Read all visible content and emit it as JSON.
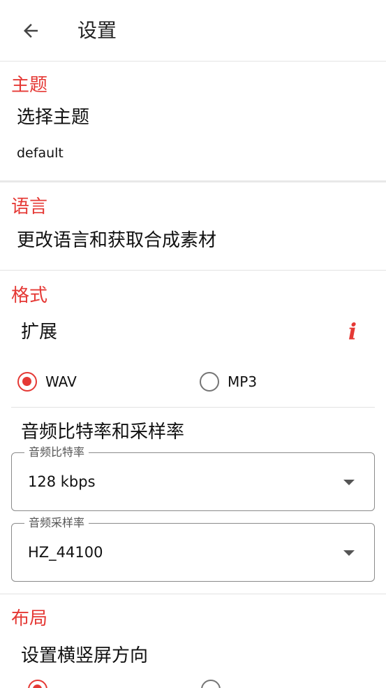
{
  "appbar": {
    "back_icon": "arrow-left-icon",
    "title": "设置"
  },
  "theme": {
    "section": "主题",
    "item_title": "选择主题",
    "item_value": "default"
  },
  "language": {
    "section": "语言",
    "item_title": "更改语言和获取合成素材"
  },
  "format": {
    "section": "格式",
    "extension_title": "扩展",
    "info_icon": "info-icon",
    "options": [
      {
        "label": "WAV",
        "selected": true
      },
      {
        "label": "MP3",
        "selected": false
      }
    ],
    "bitrate_title": "音频比特率和采样率",
    "bitrate": {
      "label": "音频比特率",
      "value": "128 kbps"
    },
    "samplerate": {
      "label": "音频采样率",
      "value": "HZ_44100"
    }
  },
  "layout": {
    "section": "布局",
    "item_title": "设置横竖屏方向"
  },
  "colors": {
    "accent": "#e53935",
    "divider": "#e2e2e2",
    "text": "#111111"
  }
}
